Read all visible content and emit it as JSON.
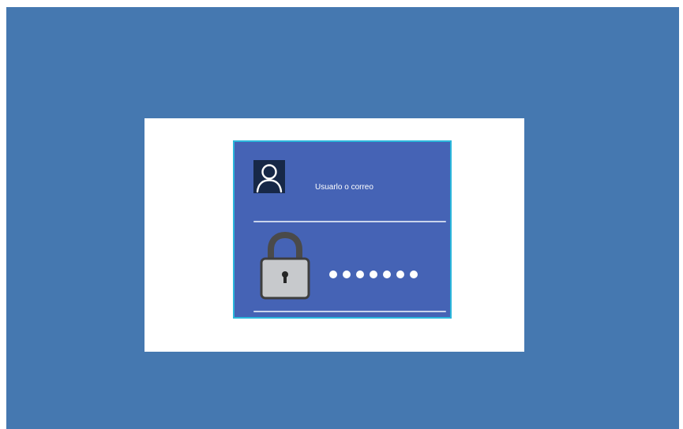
{
  "login": {
    "username_label": "Usuarlo o correo",
    "password_mask_length": 7,
    "icons": {
      "user": "user-icon",
      "lock": "lock-icon"
    }
  },
  "colors": {
    "background": "#4578b0",
    "frame": "#ffffff",
    "card": "#4563b5",
    "card_border": "#2bb7dc",
    "avatar_bg": "#172847",
    "divider": "#c9d4ec",
    "lock_body": "#c7c9cc",
    "lock_shackle": "#4a4a4a"
  }
}
